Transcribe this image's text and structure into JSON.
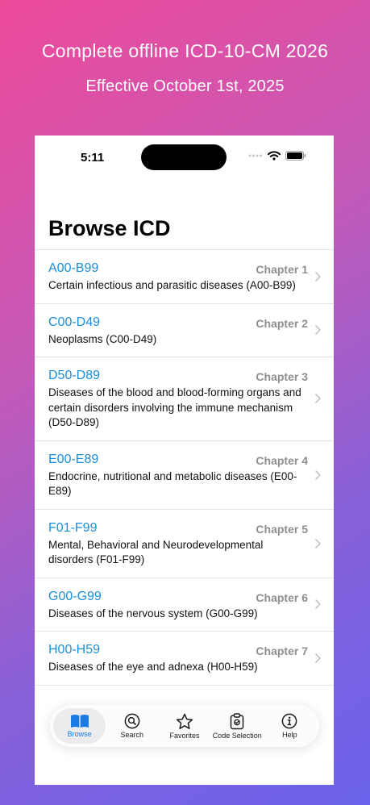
{
  "promo": {
    "title": "Complete offline ICD-10-CM 2026",
    "subtitle": "Effective October 1st, 2025"
  },
  "status_bar": {
    "time": "5:11"
  },
  "page": {
    "title": "Browse ICD"
  },
  "chapters": [
    {
      "code": "A00-B99",
      "chapter": "Chapter 1",
      "description": "Certain infectious and parasitic diseases (A00-B99)"
    },
    {
      "code": "C00-D49",
      "chapter": "Chapter 2",
      "description": "Neoplasms (C00-D49)"
    },
    {
      "code": "D50-D89",
      "chapter": "Chapter 3",
      "description": "Diseases of the blood and blood-forming organs and certain disorders involving the immune mechanism (D50-D89)"
    },
    {
      "code": "E00-E89",
      "chapter": "Chapter 4",
      "description": "Endocrine, nutritional and metabolic diseases (E00-E89)"
    },
    {
      "code": "F01-F99",
      "chapter": "Chapter 5",
      "description": "Mental, Behavioral and Neurodevelopmental disorders (F01-F99)"
    },
    {
      "code": "G00-G99",
      "chapter": "Chapter 6",
      "description": "Diseases of the nervous system (G00-G99)"
    },
    {
      "code": "H00-H59",
      "chapter": "Chapter 7",
      "description": "Diseases of the eye and adnexa (H00-H59)"
    }
  ],
  "tabs": [
    {
      "label": "Browse",
      "icon": "book-icon",
      "active": true
    },
    {
      "label": "Search",
      "icon": "search-icon",
      "active": false
    },
    {
      "label": "Favorites",
      "icon": "star-icon",
      "active": false
    },
    {
      "label": "Code Selection",
      "icon": "clipboard-icon",
      "active": false
    },
    {
      "label": "Help",
      "icon": "info-icon",
      "active": false
    }
  ],
  "colors": {
    "accent": "#1a8fd8",
    "tab_active": "#1a7be6",
    "secondary": "#8e8e93"
  }
}
